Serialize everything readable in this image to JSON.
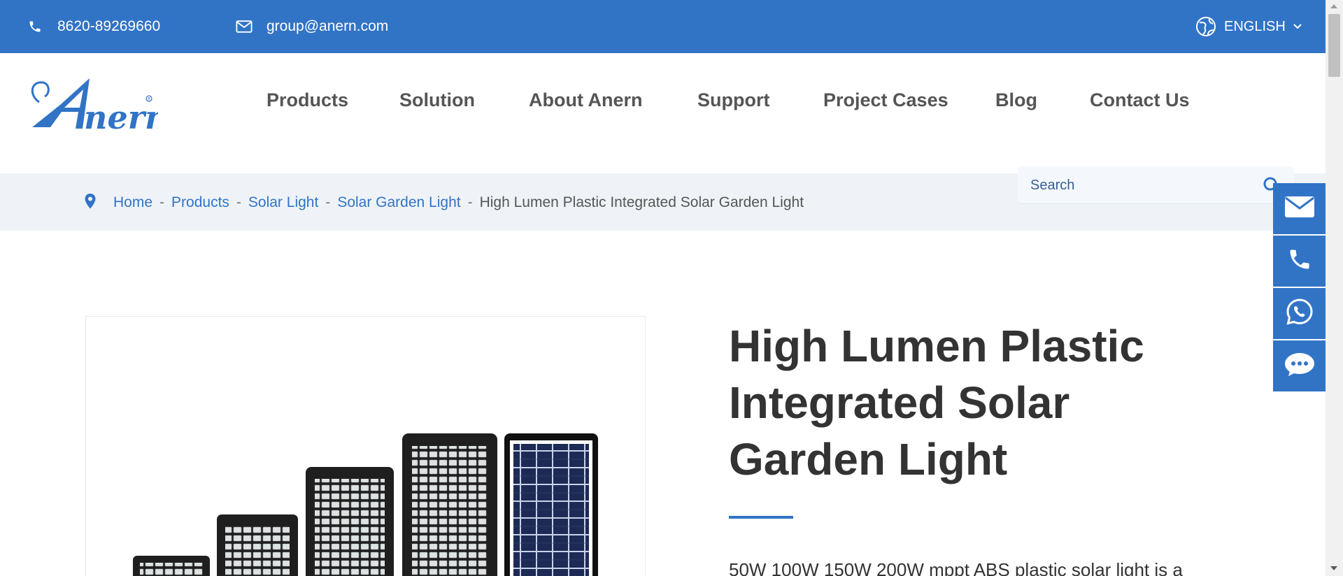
{
  "topbar": {
    "phone": "8620-89269660",
    "email": "group@anern.com",
    "language": "ENGLISH"
  },
  "brand": {
    "logo_text": "Anern"
  },
  "nav": [
    "Products",
    "Solution",
    "About Anern",
    "Support",
    "Project Cases",
    "Blog",
    "Contact Us"
  ],
  "search": {
    "placeholder": "Search"
  },
  "breadcrumb": {
    "items": [
      "Home",
      "Products",
      "Solar Light",
      "Solar Garden Light"
    ],
    "current": "High Lumen Plastic Integrated Solar Garden Light",
    "separator": "-"
  },
  "product": {
    "title_lines": [
      "High Lumen Plastic",
      "Integrated Solar",
      "Garden Light"
    ],
    "description": "50W 100W 150W 200W mppt ABS plastic solar light is a"
  },
  "side_buttons": [
    "mail-icon",
    "phone-icon",
    "whatsapp-icon",
    "chat-icon"
  ],
  "colors": {
    "accent": "#3174c6",
    "band": "#eff3f7"
  }
}
